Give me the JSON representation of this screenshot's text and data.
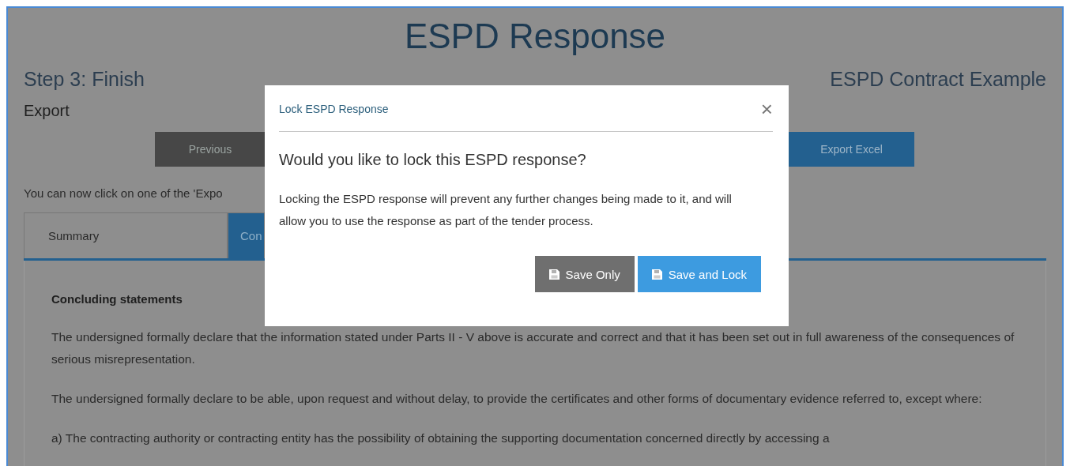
{
  "page": {
    "title": "ESPD Response",
    "step": "Step 3: Finish",
    "contract": "ESPD Contract Example",
    "section": "Export",
    "buttons": [
      {
        "label": "Previous",
        "kind": "secondary"
      },
      {
        "label": "Export Excel",
        "kind": "primary"
      }
    ],
    "instruction": "You can now click on one of the 'Expo",
    "tabs": [
      {
        "label": "Summary",
        "selected": false
      },
      {
        "label": "Con",
        "selected": true
      }
    ],
    "content": {
      "heading": "Concluding statements",
      "paragraphs": [
        "The undersigned formally declare that the information stated under Parts II - V above is accurate and correct and that it has been set out in full awareness of the consequences of serious misrepresentation.",
        "The undersigned formally declare to be able, upon request and without delay, to provide the certificates and other forms of documentary evidence referred to, except where:",
        "a) The contracting authority or contracting entity has the possibility of obtaining the supporting documentation concerned directly by accessing a"
      ]
    }
  },
  "dialog": {
    "title": "Lock ESPD Response",
    "close": "×",
    "question": "Would you like to lock this ESPD response?",
    "message": "Locking the ESPD response will prevent any further changes being made to it, and will allow you to use the response as part of the tender process.",
    "buttons": [
      {
        "label": "Save Only",
        "kind": "secondary"
      },
      {
        "label": "Save and Lock",
        "kind": "primary"
      }
    ]
  }
}
